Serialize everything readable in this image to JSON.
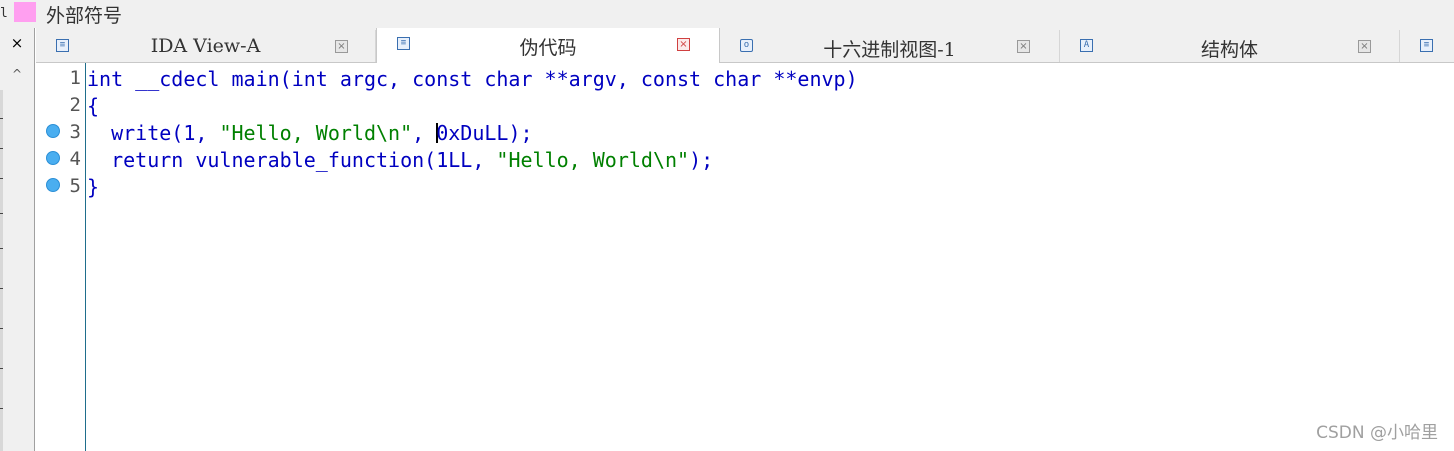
{
  "legend": {
    "stub": "l",
    "swatch_color": "#ff9ff0",
    "label": "外部符号"
  },
  "left_pane": {
    "close_glyph": "×",
    "scroll_up_glyph": "^"
  },
  "tabs": [
    {
      "label": "IDA View-A",
      "icon": "disassembly-view-icon",
      "active": false
    },
    {
      "label": "伪代码",
      "icon": "pseudocode-view-icon",
      "active": true
    },
    {
      "label": "十六进制视图-1",
      "icon": "hex-view-icon",
      "active": false
    },
    {
      "label": "结构体",
      "icon": "structures-icon",
      "active": false
    },
    {
      "label": "",
      "icon": "enums-view-icon",
      "active": false
    }
  ],
  "tab_close_glyph": "×",
  "code": {
    "line_numbers": [
      "1",
      "2",
      "3",
      "4",
      "5"
    ],
    "breakpoint_lines": [
      "3",
      "4",
      "5"
    ],
    "lines": {
      "l1": "int __cdecl main(int argc, const char **argv, const char **envp)",
      "l2": "{",
      "l3_pre": "  write(1, ",
      "l3_str": "\"Hello, World\\n\"",
      "l3_mid": ", ",
      "l3_post": "0xDuLL);",
      "l4_pre": "  return vulnerable_function(1LL, ",
      "l4_str": "\"Hello, World\\n\"",
      "l4_post": ");",
      "l5": "}"
    }
  },
  "watermark": "CSDN @小哈里"
}
